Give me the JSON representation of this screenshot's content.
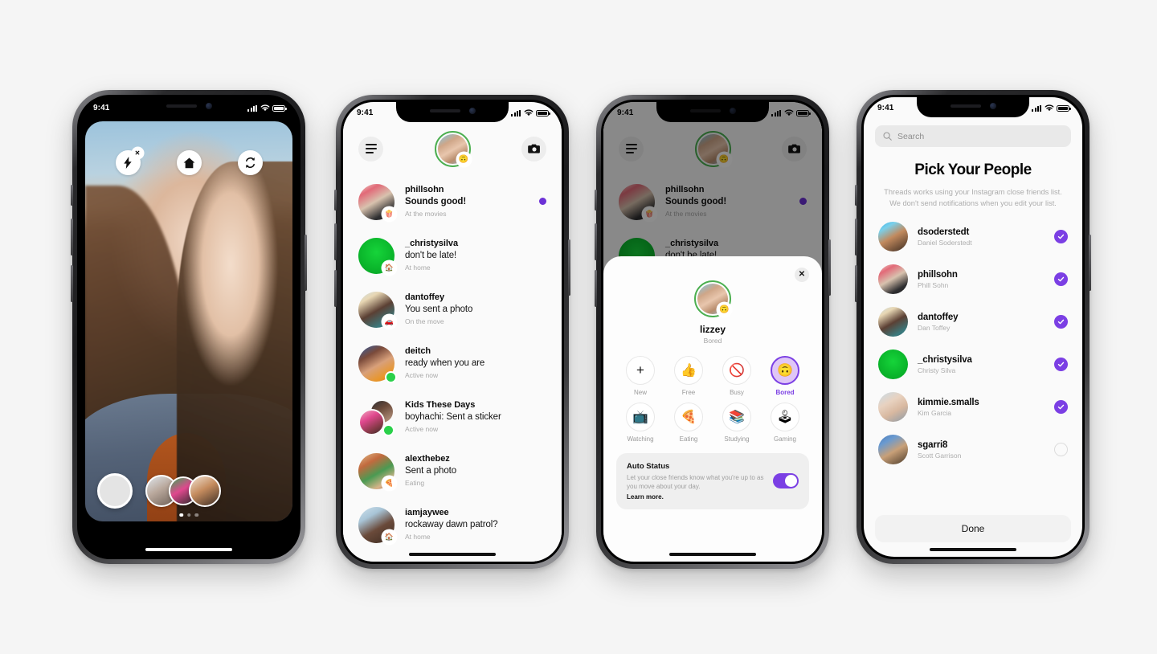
{
  "status_bar": {
    "time": "9:41"
  },
  "camera_screen": {
    "controls": [
      {
        "name": "flash-off-button",
        "icon": "flash-off-icon"
      },
      {
        "name": "home-button",
        "icon": "home-icon"
      },
      {
        "name": "flip-camera-button",
        "icon": "flip-camera-icon"
      }
    ],
    "shutter_label": "shutter-button",
    "page_dots": 3,
    "active_dot": 1
  },
  "inbox": {
    "menu_icon": "hamburger-menu-icon",
    "camera_icon": "camera-icon",
    "avatar_status_emoji": "🙃",
    "rows": [
      {
        "user": "phillsohn",
        "msg": "Sounds good!",
        "bold": true,
        "sub": "At the movies",
        "badge": "🍿",
        "unread": true,
        "av": "phillsohn",
        "online": false
      },
      {
        "user": "_christysilva",
        "msg": "don't be late!",
        "bold": false,
        "sub": "At home",
        "badge": "🏠",
        "unread": false,
        "av": "christy",
        "online": false
      },
      {
        "user": "dantoffey",
        "msg": "You sent a photo",
        "bold": false,
        "sub": "On the move",
        "badge": "🚗",
        "unread": false,
        "av": "dantoffey",
        "online": false
      },
      {
        "user": "deitch",
        "msg": "ready when you are",
        "bold": false,
        "sub": "Active now",
        "badge": "",
        "unread": false,
        "av": "deitch",
        "online": true
      },
      {
        "user": "Kids These Days",
        "msg": "boyhachi: Sent a sticker",
        "bold": false,
        "sub": "Active now",
        "badge": "",
        "unread": false,
        "av": "group",
        "online": true
      },
      {
        "user": "alexthebez",
        "msg": "Sent a photo",
        "bold": false,
        "sub": "Eating",
        "badge": "🍕",
        "unread": false,
        "av": "alex",
        "online": false
      },
      {
        "user": "iamjaywee",
        "msg": "rockaway dawn patrol?",
        "bold": false,
        "sub": "At home",
        "badge": "🏠",
        "unread": false,
        "av": "jaywee",
        "online": false
      }
    ]
  },
  "status_sheet": {
    "close_icon": "close-icon",
    "name": "lizzey",
    "current_status": "Bored",
    "options": [
      {
        "label": "New",
        "emoji": "+",
        "selected": false
      },
      {
        "label": "Free",
        "emoji": "👍",
        "selected": false
      },
      {
        "label": "Busy",
        "emoji": "🚫",
        "selected": false
      },
      {
        "label": "Bored",
        "emoji": "🙃",
        "selected": true
      },
      {
        "label": "Watching",
        "emoji": "📺",
        "selected": false
      },
      {
        "label": "Eating",
        "emoji": "🍕",
        "selected": false
      },
      {
        "label": "Studying",
        "emoji": "📚",
        "selected": false
      },
      {
        "label": "Gaming",
        "emoji": "🕹",
        "selected": false
      }
    ],
    "auto_status": {
      "title": "Auto Status",
      "description": "Let your close friends know what you're up to as you move about your day.",
      "link": "Learn more.",
      "enabled": true
    }
  },
  "pick_people": {
    "search_placeholder": "Search",
    "search_icon": "search-icon",
    "title": "Pick Your People",
    "description": "Threads works using your Instagram close friends list. We don't send notifications when you edit your list.",
    "people": [
      {
        "user": "dsoderstedt",
        "name": "Daniel Soderstedt",
        "selected": true,
        "av": "dsoder"
      },
      {
        "user": "phillsohn",
        "name": "Phill Sohn",
        "selected": true,
        "av": "phillsohn"
      },
      {
        "user": "dantoffey",
        "name": "Dan Toffey",
        "selected": true,
        "av": "dantoffey"
      },
      {
        "user": "_christysilva",
        "name": "Christy Silva",
        "selected": true,
        "av": "christy"
      },
      {
        "user": "kimmie.smalls",
        "name": "Kim Garcia",
        "selected": true,
        "av": "kimmie"
      },
      {
        "user": "sgarri8",
        "name": "Scott Garrison",
        "selected": false,
        "av": "sgarri"
      }
    ],
    "done_label": "Done"
  },
  "colors": {
    "accent_purple": "#7b3fe4",
    "unread_dot": "#6c31d6",
    "online_green": "#2ad04a",
    "page_bg": "#f5f5f5"
  }
}
